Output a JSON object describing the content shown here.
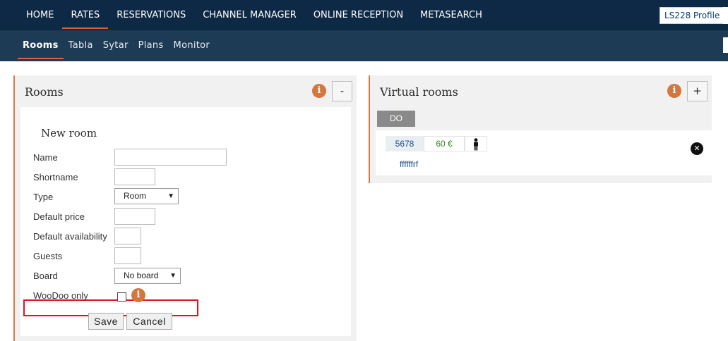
{
  "topnav": {
    "items": [
      {
        "label": "HOME"
      },
      {
        "label": "RATES"
      },
      {
        "label": "RESERVATIONS"
      },
      {
        "label": "CHANNEL MANAGER"
      },
      {
        "label": "ONLINE RECEPTION"
      },
      {
        "label": "METASEARCH"
      }
    ],
    "active_index": 1,
    "profile_label": "LS228 Profile"
  },
  "subnav": {
    "items": [
      {
        "label": "Rooms"
      },
      {
        "label": "Tabla"
      },
      {
        "label": "Sytar"
      },
      {
        "label": "Plans"
      },
      {
        "label": "Monitor"
      }
    ],
    "active_index": 0
  },
  "rooms_panel": {
    "title": "Rooms",
    "info_icon": "i",
    "collapse_label": "-",
    "new_room": {
      "title": "New room",
      "fields": {
        "name": {
          "label": "Name",
          "value": ""
        },
        "shortname": {
          "label": "Shortname",
          "value": ""
        },
        "type": {
          "label": "Type",
          "selected": "Room"
        },
        "default_price": {
          "label": "Default price",
          "value": ""
        },
        "default_availability": {
          "label": "Default availability",
          "value": ""
        },
        "guests": {
          "label": "Guests",
          "value": ""
        },
        "board": {
          "label": "Board",
          "selected": "No board"
        },
        "woodoo_only": {
          "label": "WooDoo only",
          "checked": false
        }
      },
      "save_label": "Save",
      "cancel_label": "Cancel"
    }
  },
  "virtual_rooms_panel": {
    "title": "Virtual rooms",
    "info_icon": "i",
    "add_label": "+",
    "group_tag": "DO",
    "rooms": [
      {
        "code": "5678",
        "price": "60 €",
        "guests_icon": "person-icon",
        "name": "ffffffrf"
      }
    ]
  },
  "colors": {
    "topbar": "#0e2945",
    "subbar": "#1d3b54",
    "accent": "#e25c42",
    "panel_border": "#d67a45",
    "highlight": "#e0141d"
  }
}
